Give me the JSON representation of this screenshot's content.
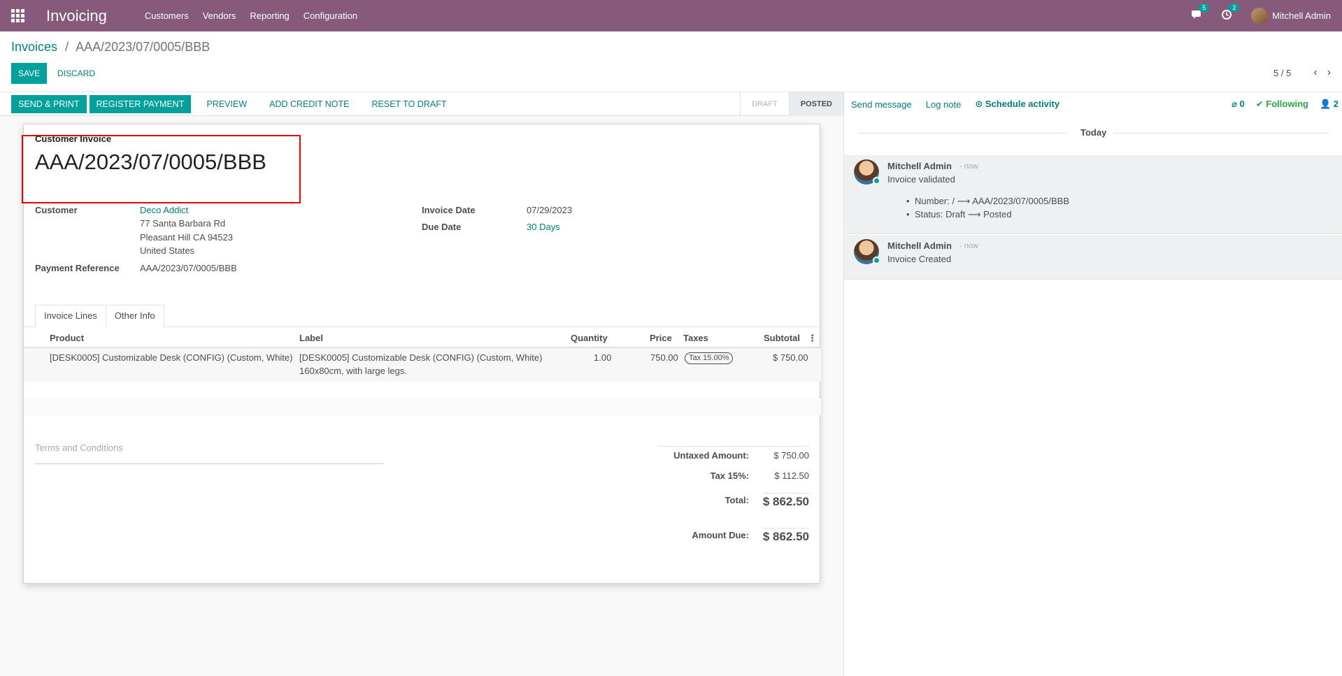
{
  "navbar": {
    "app_name": "Invoicing",
    "menu": [
      "Customers",
      "Vendors",
      "Reporting",
      "Configuration"
    ],
    "messages_count": "5",
    "activities_count": "2",
    "user_name": "Mitchell Admin"
  },
  "control_panel": {
    "breadcrumb_parent": "Invoices",
    "breadcrumb_sep": "/",
    "breadcrumb_current": "AAA/2023/07/0005/BBB",
    "save_label": "SAVE",
    "discard_label": "DISCARD",
    "pager_value": "5 / 5",
    "pager_prev": "‹",
    "pager_next": "›"
  },
  "statusbar": {
    "send_print": "SEND & PRINT",
    "register_payment": "REGISTER PAYMENT",
    "preview": "PREVIEW",
    "add_credit_note": "ADD CREDIT NOTE",
    "reset_to_draft": "RESET TO DRAFT",
    "steps": [
      "DRAFT",
      "POSTED"
    ],
    "active_step": "POSTED"
  },
  "sheet": {
    "move_type": "Customer Invoice",
    "name": "AAA/2023/07/0005/BBB",
    "customer_label": "Customer",
    "customer_name": "Deco Addict",
    "customer_address": [
      "77 Santa Barbara Rd",
      "Pleasant Hill CA 94523",
      "United States"
    ],
    "payment_ref_label": "Payment Reference",
    "payment_ref_value": "AAA/2023/07/0005/BBB",
    "invoice_date_label": "Invoice Date",
    "invoice_date_value": "07/29/2023",
    "due_date_label": "Due Date",
    "due_date_value": "30 Days",
    "tabs": [
      "Invoice Lines",
      "Other Info"
    ],
    "lines_columns": [
      "Product",
      "Label",
      "Quantity",
      "Price",
      "Taxes",
      "Subtotal"
    ],
    "lines": [
      {
        "product": "[DESK0005] Customizable Desk (CONFIG) (Custom, White)",
        "label_line1": "[DESK0005] Customizable Desk (CONFIG) (Custom, White)",
        "label_line2": "160x80cm, with large legs.",
        "quantity": "1.00",
        "price": "750.00",
        "tax": "Tax 15.00%",
        "subtotal": "$ 750.00"
      }
    ],
    "terms_placeholder": "Terms and Conditions",
    "totals": {
      "untaxed_label": "Untaxed Amount:",
      "untaxed_value": "$ 750.00",
      "tax_label": "Tax 15%:",
      "tax_value": "$ 112.50",
      "total_label": "Total:",
      "total_value": "$ 862.50",
      "due_label": "Amount Due:",
      "due_value": "$ 862.50"
    }
  },
  "chatter": {
    "send_message": "Send message",
    "log_note": "Log note",
    "schedule_activity": "Schedule activity",
    "attachments": "0",
    "following": "Following",
    "followers": "2",
    "date_separator": "Today",
    "messages": [
      {
        "author": "Mitchell Admin",
        "date": "- now",
        "body": "Invoice validated",
        "tracking": [
          "Number: / ⟶ AAA/2023/07/0005/BBB",
          "Status: Draft ⟶ Posted"
        ]
      },
      {
        "author": "Mitchell Admin",
        "date": "- now",
        "body": "Invoice Created",
        "tracking": []
      }
    ]
  },
  "colors": {
    "brand": "#875a7b",
    "primary": "#00a09d",
    "link": "#017e84",
    "highlight_box": "#ee0000"
  }
}
